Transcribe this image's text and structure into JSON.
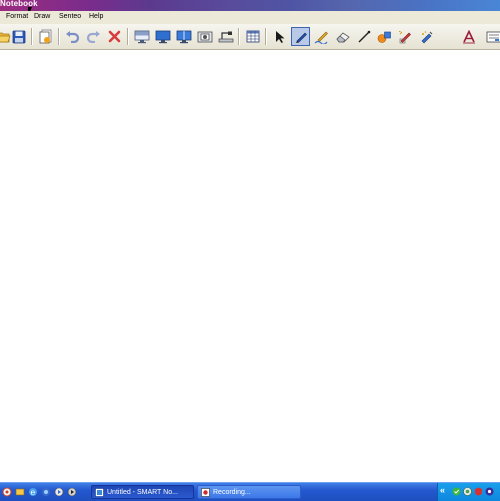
{
  "window": {
    "title": "Notebook"
  },
  "menu": {
    "items": [
      "Format",
      "Draw",
      "Senteo",
      "Help"
    ]
  },
  "toolbar": {
    "buttons": [
      "open-icon",
      "save-icon",
      "insert-page-icon",
      "undo-icon",
      "redo-icon",
      "delete-icon",
      "screen-shade-icon",
      "full-screen-icon",
      "dual-page-icon",
      "capture-icon",
      "document-camera-icon",
      "table-icon",
      "select-icon",
      "pen-icon",
      "creative-pen-icon",
      "eraser-icon",
      "line-icon",
      "shape-icon",
      "magic-pen-icon",
      "fill-icon",
      "text-icon"
    ],
    "active": "pen-icon"
  },
  "taskbar": {
    "tasks": [
      {
        "label": "Untitled - SMART No...",
        "active": true
      },
      {
        "label": "Recording...",
        "active": false
      }
    ],
    "tray_chevron": "«"
  },
  "colors": {
    "toolbar_bg": "#ece9d8",
    "taskbar_blue": "#2358d0",
    "tray_blue": "#0d86dc",
    "active_button": "#b9c9e8"
  }
}
